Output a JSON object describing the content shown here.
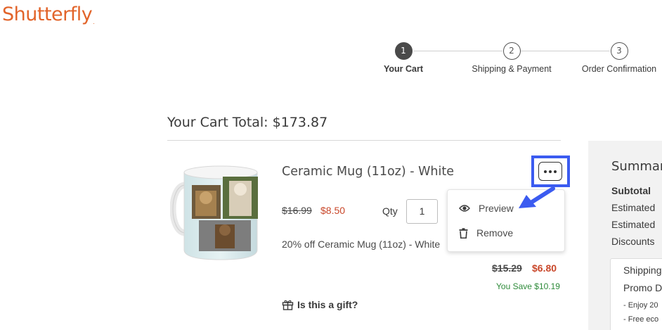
{
  "brand": {
    "name": "Shutterfly",
    "tm": "."
  },
  "stepper": {
    "steps": [
      {
        "number": "1",
        "label": "Your Cart",
        "active": true
      },
      {
        "number": "2",
        "label": "Shipping & Payment",
        "active": false
      },
      {
        "number": "3",
        "label": "Order Confirmation",
        "active": false
      }
    ]
  },
  "cart": {
    "total_label": "Your Cart Total: $173.87"
  },
  "item": {
    "title": "Ceramic Mug (11oz) - White",
    "price_original": "$16.99",
    "price_sale": "$8.50",
    "qty_label": "Qty",
    "qty_value": "1",
    "promo": "20% off Ceramic Mug (11oz) - White",
    "subtotal_original": "$15.29",
    "subtotal_sale": "$6.80",
    "you_save": "You Save $10.19",
    "gift_label": "Is this a gift?"
  },
  "item_menu": {
    "preview_label": "Preview",
    "remove_label": "Remove"
  },
  "summary": {
    "title": "Summary",
    "rows": [
      "Subtotal",
      "Estimated",
      "Estimated",
      "Discounts"
    ],
    "card": {
      "line1": "Shipping",
      "line2": "Promo D",
      "line3": "- Enjoy 20",
      "line4": "- Free eco"
    }
  },
  "colors": {
    "brand": "#e2642a",
    "sale_price": "#c9472a",
    "savings": "#2e8b3a",
    "highlight": "#3b5bf0"
  }
}
